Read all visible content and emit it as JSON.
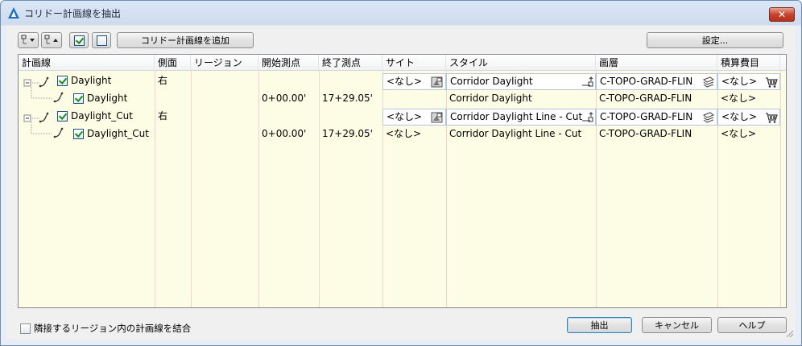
{
  "window": {
    "title": "コリドー計画線を抽出",
    "close_glyph": "✕"
  },
  "toolbar": {
    "expand_icon": "tree-expand-icon",
    "collapse_icon": "tree-collapse-icon",
    "check_all_icon": "check-all-icon",
    "uncheck_all_icon": "uncheck-all-icon",
    "add_label": "コリドー計画線を追加",
    "settings_label": "設定..."
  },
  "grid": {
    "columns": [
      "計画線",
      "側面",
      "リージョン",
      "開始測点",
      "終了測点",
      "サイト",
      "スタイル",
      "画層",
      "積算費目"
    ],
    "rows": [
      {
        "name": "Daylight",
        "side": "右",
        "region": "",
        "start": "",
        "end": "",
        "site": "<なし>",
        "style": "Corridor Daylight",
        "layer": "C-TOPO-GRAD-FLIN",
        "pay": "<なし>",
        "checked": true,
        "level": 0,
        "editable": true
      },
      {
        "name": "Daylight",
        "side": "",
        "region": "",
        "start": "0+00.00'",
        "end": "17+29.05'",
        "site": "",
        "style": "Corridor Daylight",
        "layer": "C-TOPO-GRAD-FLIN",
        "pay": "<なし>",
        "checked": true,
        "level": 1,
        "editable": false
      },
      {
        "name": "Daylight_Cut",
        "side": "右",
        "region": "",
        "start": "",
        "end": "",
        "site": "<なし>",
        "style": "Corridor Daylight Line - Cut",
        "layer": "C-TOPO-GRAD-FLIN",
        "pay": "<なし>",
        "checked": true,
        "level": 0,
        "editable": true
      },
      {
        "name": "Daylight_Cut",
        "side": "",
        "region": "",
        "start": "0+00.00'",
        "end": "17+29.05'",
        "site": "<なし>",
        "style": "Corridor Daylight Line - Cut",
        "layer": "C-TOPO-GRAD-FLIN",
        "pay": "<なし>",
        "checked": true,
        "level": 1,
        "editable": false
      }
    ]
  },
  "footer": {
    "merge_label": "隣接するリージョン内の計画線を結合",
    "merge_checked": false,
    "extract_label": "抽出",
    "cancel_label": "キャンセル",
    "help_label": "ヘルプ"
  }
}
